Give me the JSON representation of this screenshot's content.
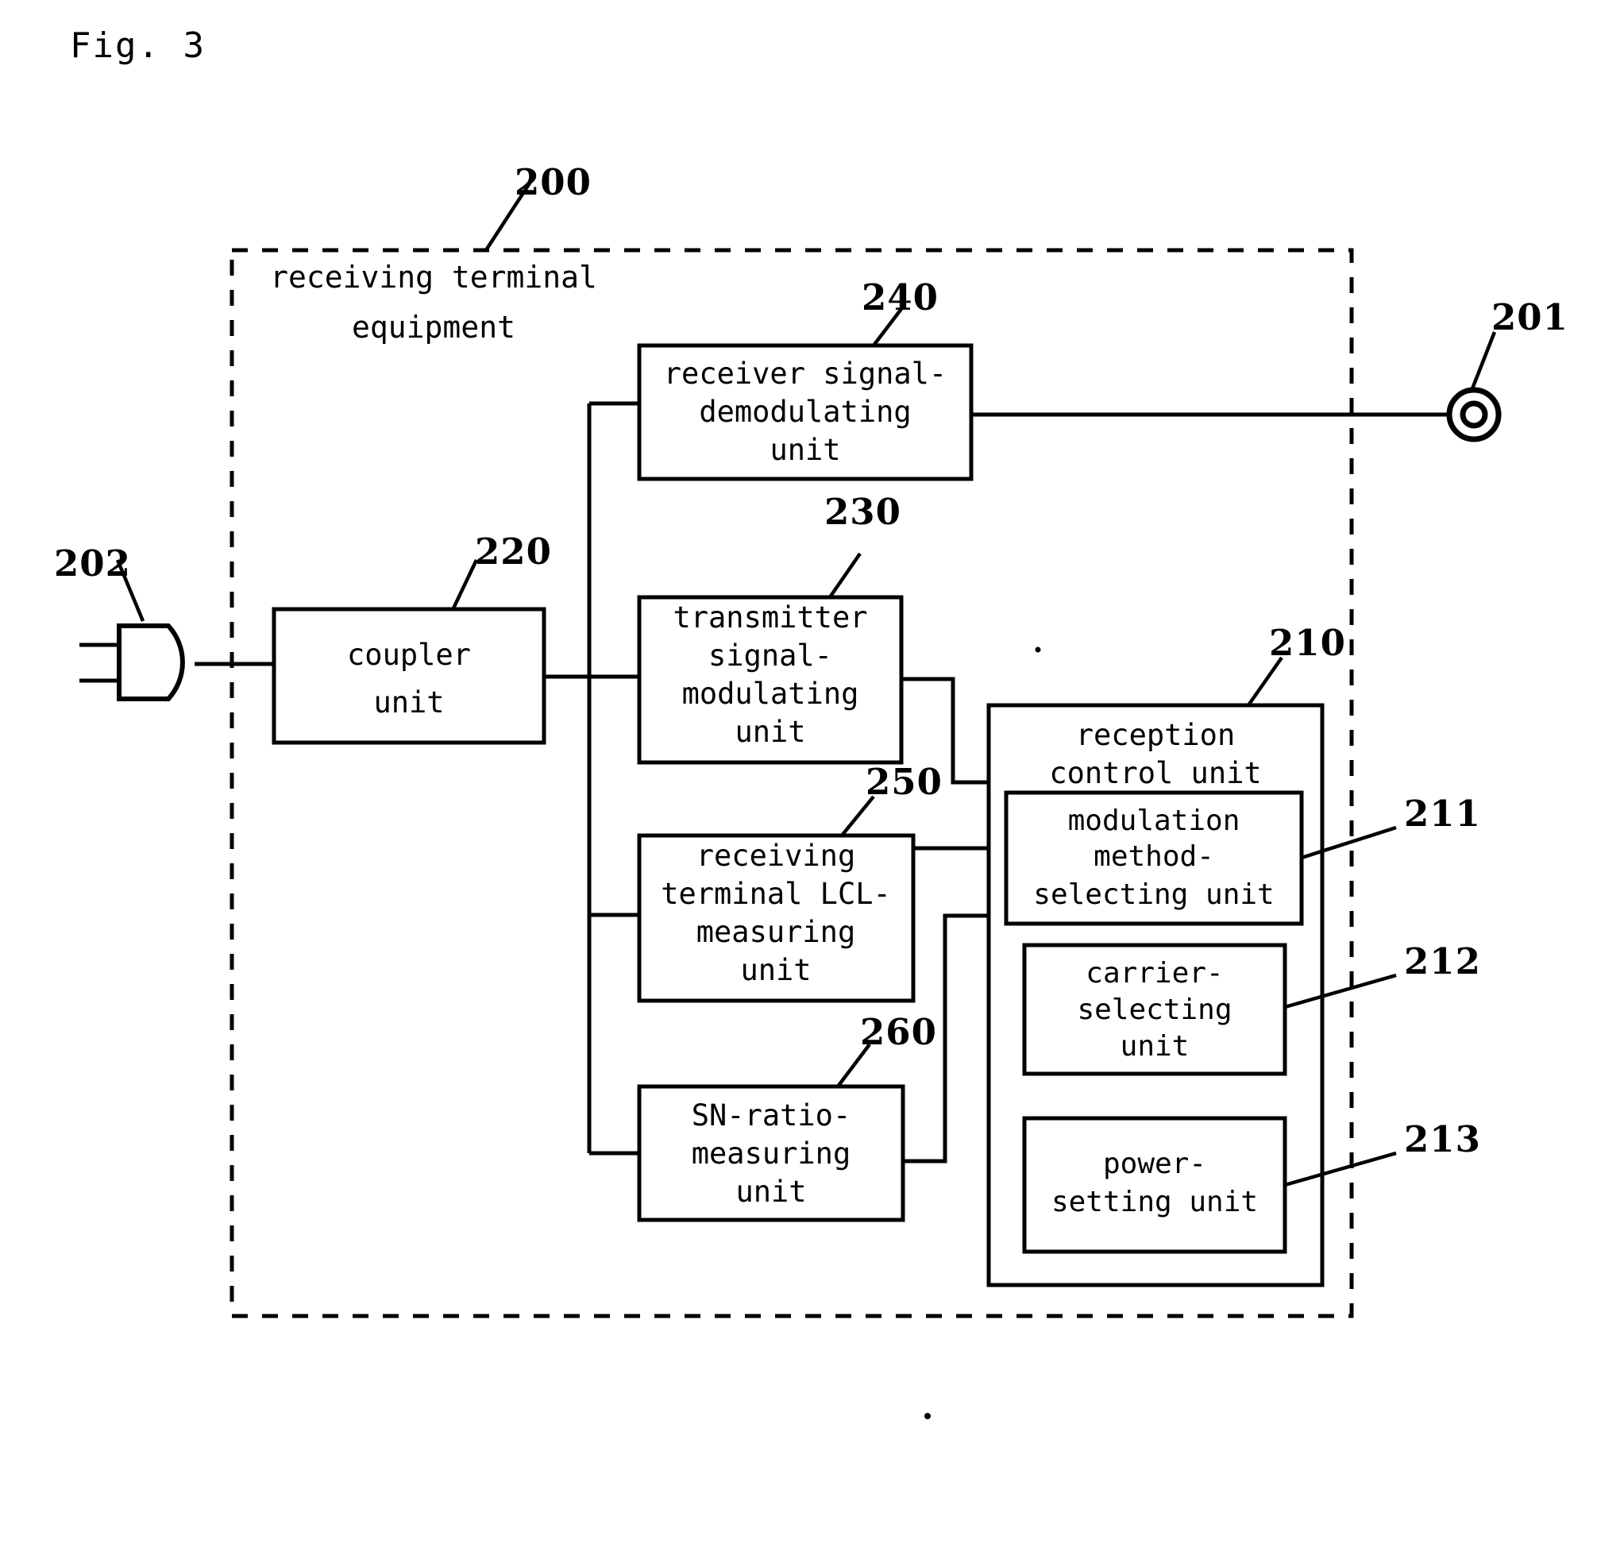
{
  "figure": {
    "title": "Fig. 3",
    "domain_note": "patent block diagram"
  },
  "outer_enclosure": {
    "ref": "200",
    "label_line1": "receiving terminal",
    "label_line2": "equipment"
  },
  "terminals": [
    {
      "ref": "201",
      "name": "output-terminal",
      "symbol": "double-circle"
    },
    {
      "ref": "202",
      "name": "input-plug",
      "symbol": "plug-connector"
    }
  ],
  "blocks": [
    {
      "ref": "240",
      "name": "receiver-signal-demodulating-unit",
      "lines": [
        "receiver signal-",
        "demodulating",
        "unit"
      ]
    },
    {
      "ref": "220",
      "name": "coupler-unit",
      "lines": [
        "coupler",
        "unit"
      ]
    },
    {
      "ref": "230",
      "name": "transmitter-signal-modulating-unit",
      "lines": [
        "transmitter",
        "signal-",
        "modulating",
        "unit"
      ]
    },
    {
      "ref": "250",
      "name": "receiving-terminal-lcl-measuring-unit",
      "lines": [
        "receiving",
        "terminal LCL-",
        "measuring",
        "unit"
      ]
    },
    {
      "ref": "260",
      "name": "sn-ratio-measuring-unit",
      "lines": [
        "SN-ratio-",
        "measuring",
        "unit"
      ]
    },
    {
      "ref": "210",
      "name": "reception-control-unit",
      "lines": [
        "reception",
        "control unit"
      ]
    },
    {
      "ref": "211",
      "name": "modulation-method-selecting-unit",
      "lines": [
        "modulation",
        "method-",
        "selecting unit"
      ]
    },
    {
      "ref": "212",
      "name": "carrier-selecting-unit",
      "lines": [
        "carrier-",
        "selecting",
        "unit"
      ]
    },
    {
      "ref": "213",
      "name": "power-setting-unit",
      "lines": [
        "power-",
        "setting unit"
      ]
    }
  ],
  "colors": {
    "ink": "#000000",
    "paper": "#ffffff"
  }
}
